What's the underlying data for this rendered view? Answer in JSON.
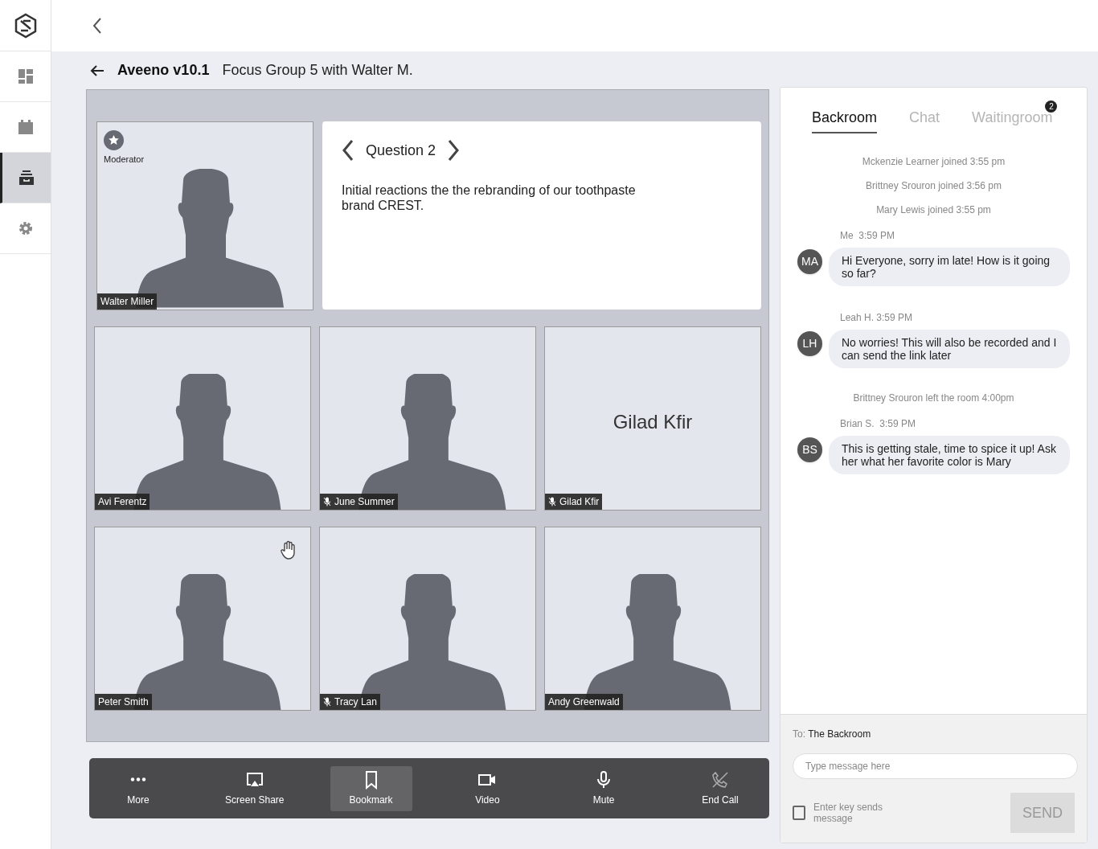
{
  "sidebar": {
    "items": [
      {
        "kind": "dashboard",
        "selected": false
      },
      {
        "kind": "calendar",
        "selected": false
      },
      {
        "kind": "archive",
        "selected": true
      },
      {
        "kind": "settings",
        "selected": false
      }
    ]
  },
  "header": {
    "project": "Aveeno v10.1",
    "session": "Focus Group 5 with Walter M."
  },
  "moderator": {
    "badge": "Moderator",
    "name": "Walter Miller"
  },
  "question": {
    "title": "Question 2",
    "text": "Initial reactions the the rebranding of our toothpaste brand CREST."
  },
  "participants": [
    {
      "name": "Avi Ferentz",
      "muted": false,
      "hand_raised": false,
      "video": true
    },
    {
      "name": "June Summer",
      "muted": true,
      "hand_raised": false,
      "video": true
    },
    {
      "name": "Gilad Kfir",
      "muted": true,
      "hand_raised": false,
      "video": false,
      "display_name": "Gilad Kfir"
    },
    {
      "name": "Peter Smith",
      "muted": false,
      "hand_raised": true,
      "video": true
    },
    {
      "name": "Tracy Lan",
      "muted": true,
      "hand_raised": false,
      "video": true
    },
    {
      "name": "Andy Greenwald",
      "muted": false,
      "hand_raised": false,
      "video": true
    }
  ],
  "toolbar": [
    {
      "kind": "more",
      "label": "More",
      "selected": false
    },
    {
      "kind": "screen-share",
      "label": "Screen Share",
      "selected": false
    },
    {
      "kind": "bookmark",
      "label": "Bookmark",
      "selected": true
    },
    {
      "kind": "video",
      "label": "Video",
      "selected": false
    },
    {
      "kind": "mute",
      "label": "Mute",
      "selected": false
    },
    {
      "kind": "end-call",
      "label": "End Call",
      "selected": false
    }
  ],
  "chat": {
    "tabs": [
      {
        "label": "Backroom",
        "selected": true
      },
      {
        "label": "Chat",
        "selected": false
      },
      {
        "label": "Waitingroom",
        "selected": false,
        "badge": "2"
      }
    ],
    "feed": [
      {
        "kind": "event",
        "text": "Mckenzie Learner joined 3:55 pm"
      },
      {
        "kind": "event",
        "text": "Brittney Srouron joined 3:56 pm"
      },
      {
        "kind": "event",
        "text": "Mary Lewis joined 3:55 pm"
      },
      {
        "kind": "message",
        "meta": "Me  3:59 PM",
        "initials": "MA",
        "text": "Hi Everyone, sorry im late! How is it going so far?"
      },
      {
        "kind": "message",
        "meta": "Leah H. 3:59 PM",
        "initials": "LH",
        "text": "No worries! This will also be recorded and I can send the link later"
      },
      {
        "kind": "event",
        "text": "Brittney Srouron left the room 4:00pm"
      },
      {
        "kind": "message",
        "meta": "Brian S.  3:59 PM",
        "initials": "BS",
        "text": "This is getting stale, time to spice it up! Ask her what her favorite color is Mary"
      }
    ],
    "compose": {
      "to_label": "To:",
      "to": "The Backroom",
      "placeholder": "Type message here",
      "enter_sends": {
        "label": "Enter key sends message",
        "checked": false
      },
      "send": {
        "label": "SEND",
        "disabled": true
      }
    }
  }
}
